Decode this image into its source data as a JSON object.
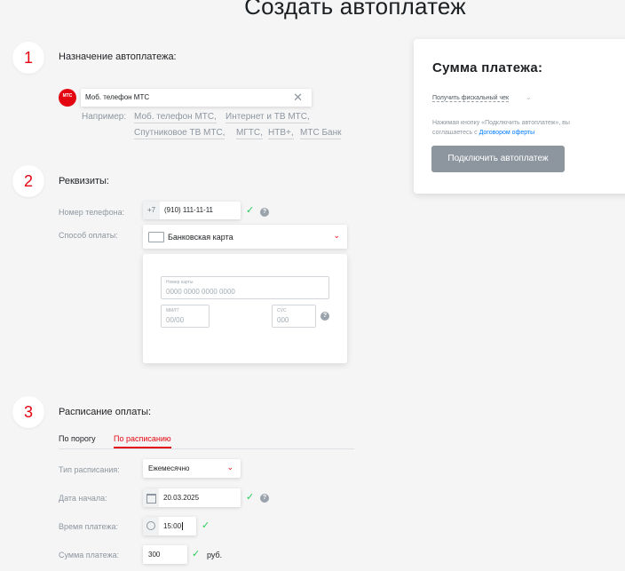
{
  "page": {
    "title": "Создать автоплатеж"
  },
  "steps": {
    "s1": {
      "number": "1",
      "title": "Назначение автоплатежа:"
    },
    "s2": {
      "number": "2",
      "title": "Реквизиты:"
    },
    "s3": {
      "number": "3",
      "title": "Расписание оплаты:"
    }
  },
  "purpose": {
    "service_value": "Моб. телефон МТС",
    "logo_text": "МТС",
    "examples_label": "Например:",
    "examples": [
      "Моб. телефон МТС,",
      "Интернет и ТВ МТС,",
      "Спутниковое ТВ МТС,",
      "МГТС,",
      "НТВ+,",
      "МТС Банк"
    ]
  },
  "requisites": {
    "phone_label": "Номер телефона:",
    "phone_prefix": "+7",
    "phone_value": "(910) 111-11-11",
    "method_label": "Способ оплаты:",
    "method_value": "Банковская карта",
    "card": {
      "number_label": "Номер карты",
      "number_placeholder": "0000 0000 0000 0000",
      "expiry_label": "ММ/ГГ",
      "expiry_placeholder": "00/00",
      "cvc_label": "CVC",
      "cvc_placeholder": "000"
    }
  },
  "schedule": {
    "tabs": [
      {
        "label": "По порогу"
      },
      {
        "label": "По расписанию"
      }
    ],
    "active_tab": "По расписанию",
    "type_label": "Тип расписания:",
    "type_value": "Ежемесячно",
    "date_label": "Дата начала:",
    "date_value": "20.03.2025",
    "time_label": "Время платежа:",
    "time_value": "15:00",
    "amount_label": "Сумма платежа:",
    "amount_value": "300",
    "amount_unit": "руб."
  },
  "summary": {
    "title": "Сумма платежа:",
    "receipt_label": "Получить фискальный чек",
    "agreement_text": "Нажимая кнопку «Подключить автоплатеж», вы соглашаетесь с",
    "agreement_link": "Договором оферты",
    "submit_label": "Подключить автоплатеж"
  },
  "colors": {
    "accent": "#e30611",
    "success": "#26cd58",
    "link": "#007cff",
    "button_disabled": "#8d969f"
  }
}
